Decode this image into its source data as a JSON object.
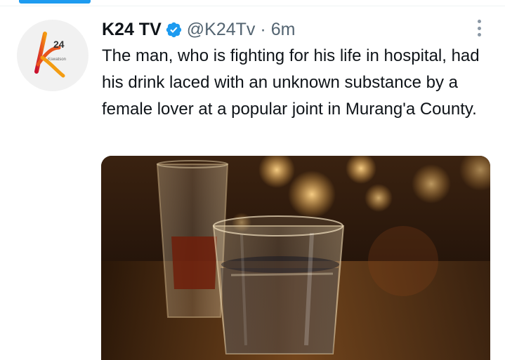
{
  "tweet": {
    "display_name": "K24 TV",
    "handle": "@K24Tv",
    "separator": "·",
    "time": "6m",
    "verified": true,
    "text": "The man, who is fighting for his life in hospital, had his drink laced with an unknown substance by a female lover at a popular joint in Murang'a County."
  },
  "avatar": {
    "logo_number": "24",
    "logo_caption": "Kswatson"
  },
  "colors": {
    "verified_blue": "#1d9bf0",
    "secondary_text": "#536471",
    "logo_red": "#c8102e",
    "logo_orange": "#f39c12"
  },
  "icons": {
    "verified": "verified-badge-icon",
    "more": "more-options-icon"
  }
}
